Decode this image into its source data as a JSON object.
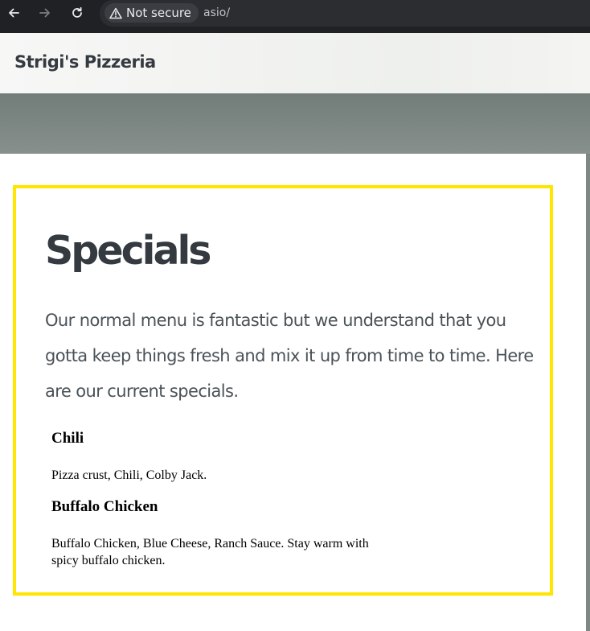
{
  "browser": {
    "security_label": "Not secure",
    "url": "asio/",
    "icons": {
      "back": "arrow-left-icon",
      "forward": "arrow-right-icon",
      "reload": "reload-icon",
      "warning": "warning-triangle-icon"
    }
  },
  "site": {
    "brand": "Strigi's Pizzeria"
  },
  "specials": {
    "title": "Specials",
    "intro": "Our normal menu is fantastic but we understand that you gotta keep things fresh and mix it up from time to time. Here are our current specials.",
    "items": [
      {
        "name": "Chili",
        "description": "Pizza crust, Chili, Colby Jack."
      },
      {
        "name": "Buffalo Chicken",
        "description": "Buffalo Chicken, Blue Cheese, Ranch Sauce. Stay warm with spicy buffalo chicken."
      }
    ]
  },
  "colors": {
    "highlight_border": "#ffe600",
    "heading_text": "#343a40",
    "chrome_background": "#202124"
  }
}
